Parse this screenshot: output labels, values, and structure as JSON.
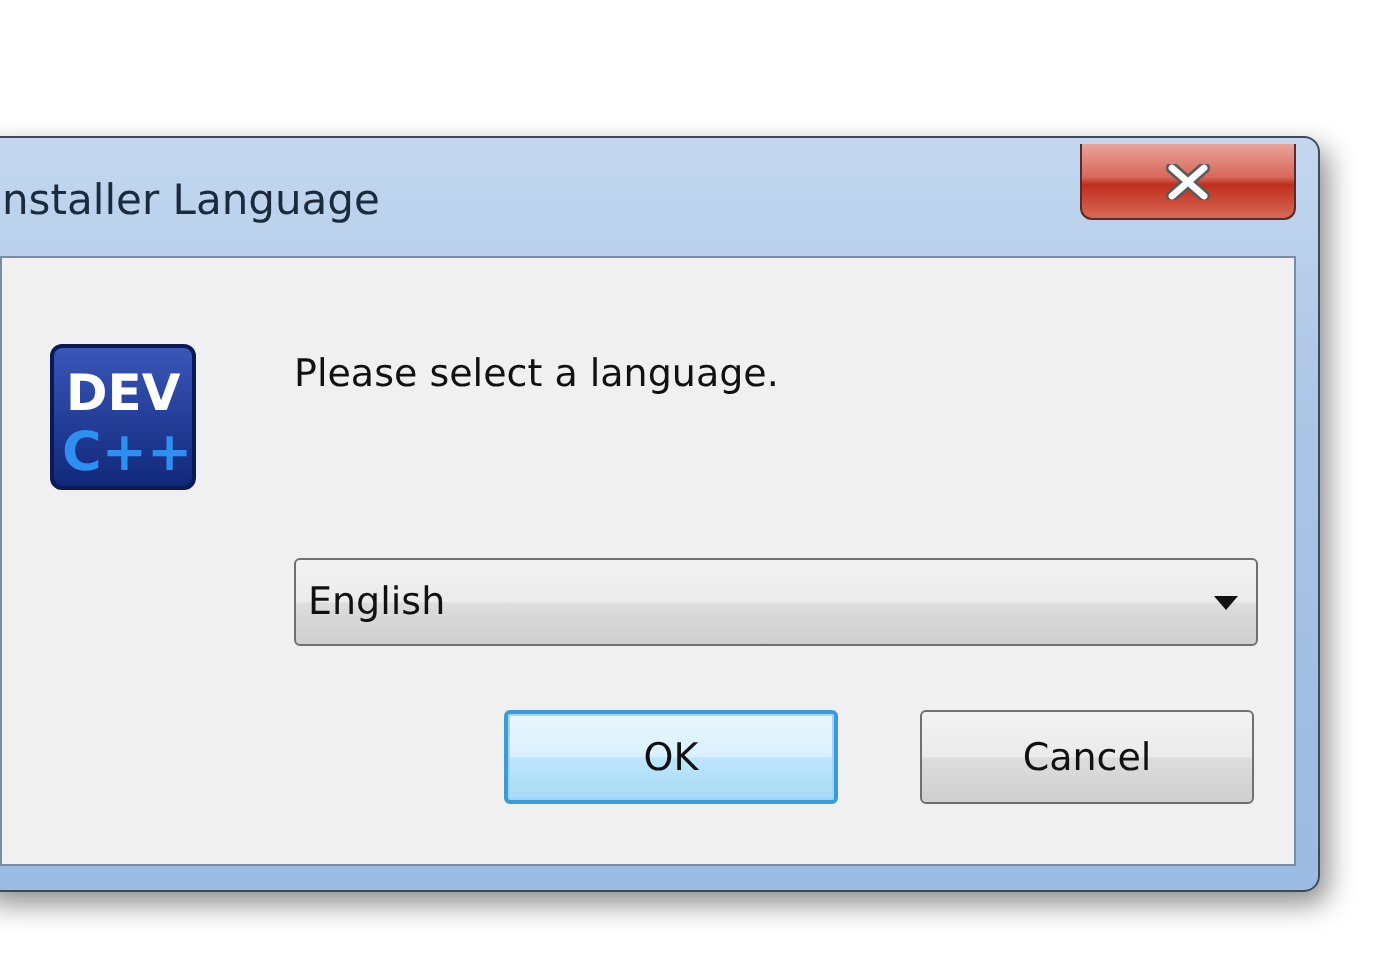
{
  "window": {
    "title": "nstaller Language"
  },
  "logo": {
    "lines": [
      "DEV",
      "C++"
    ]
  },
  "message": "Please select a language.",
  "language_dropdown": {
    "value": "English"
  },
  "buttons": [
    {
      "label": "OK",
      "default": true
    },
    {
      "label": "Cancel",
      "default": false
    }
  ]
}
